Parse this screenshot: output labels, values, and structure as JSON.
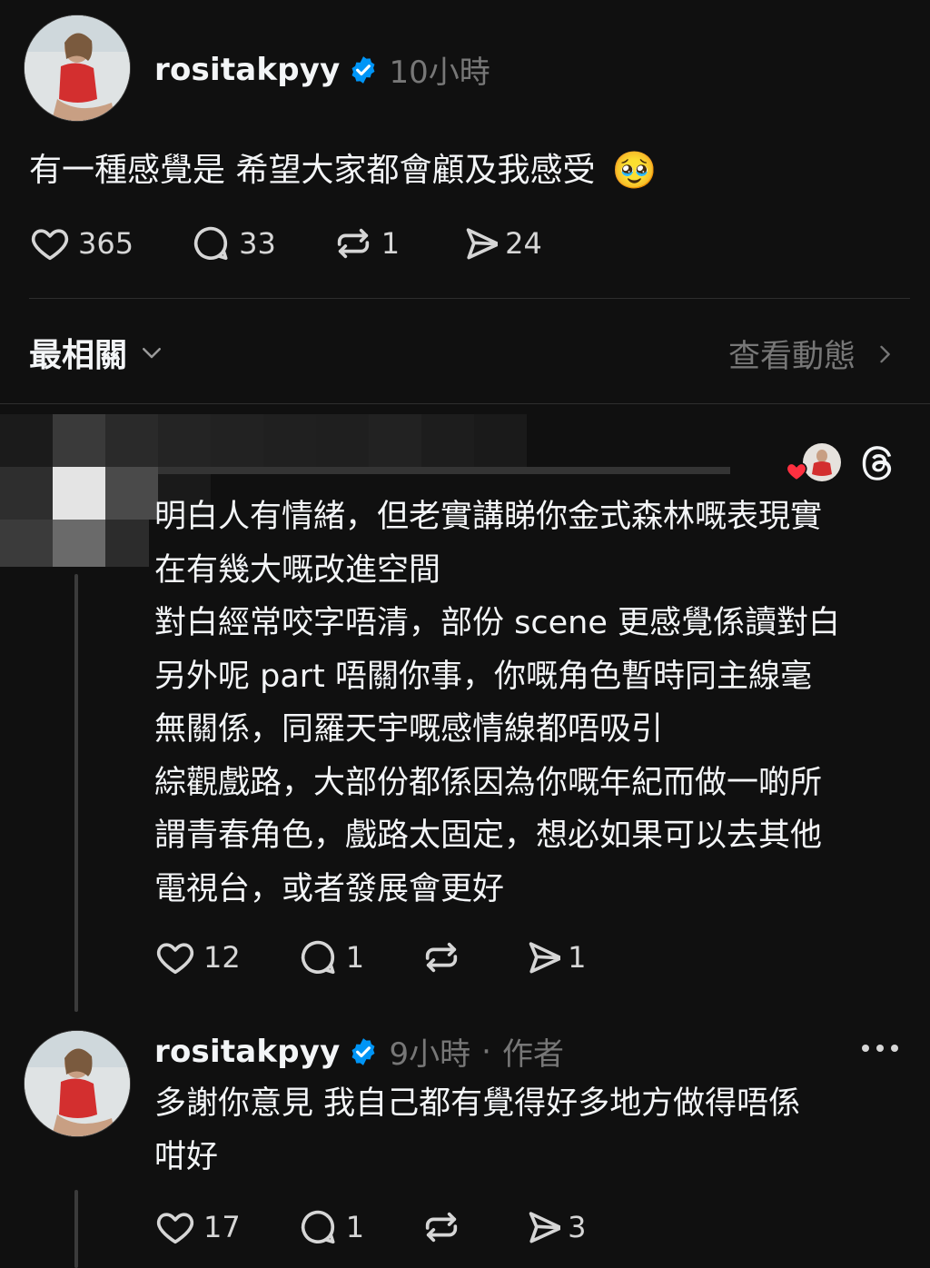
{
  "post": {
    "username": "rositakpyy",
    "time": "10小時",
    "text": "有一種感覺是 希望大家都會顧及我感受",
    "emoji": "🥹",
    "likes": "365",
    "replies": "33",
    "reposts": "1",
    "shares": "24"
  },
  "sort": {
    "label": "最相關",
    "view_activity": "查看動態"
  },
  "comment": {
    "lines": [
      "明白人有情緒，但老實講睇你金式森林嘅表現實",
      "在有幾大嘅改進空間",
      "對白經常咬字唔清，部份 scene 更感覺係讀對白",
      "另外呢 part 唔關你事，你嘅角色暫時同主線毫",
      "無關係，同羅天宇嘅感情線都唔吸引",
      "綜觀戲路，大部份都係因為你嘅年紀而做一啲所",
      "謂青春角色，戲路太固定，想必如果可以去其他",
      "電視台，或者發展會更好"
    ],
    "likes": "12",
    "replies": "1",
    "shares": "1"
  },
  "reply": {
    "username": "rositakpyy",
    "time": "9小時",
    "separator": "·",
    "author_tag": "作者",
    "lines": [
      "多謝你意見 我自己都有覺得好多地方做得唔係",
      "咁好"
    ],
    "likes": "17",
    "replies": "1",
    "shares": "3"
  },
  "colors": {
    "background": "#101010",
    "verified": "#0095f6",
    "liked_heart": "#ff3040",
    "muted": "#777777"
  }
}
